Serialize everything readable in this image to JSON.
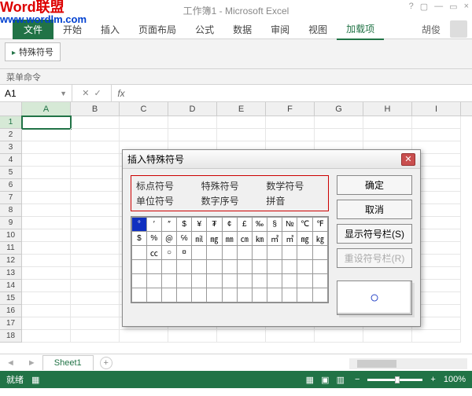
{
  "watermark": {
    "line1": "Word联盟",
    "line2": "www.wordlm.com"
  },
  "titlebar": {
    "title": "工作簿1 - Microsoft Excel"
  },
  "ribbon": {
    "tabs": {
      "file": "文件",
      "start": "开始",
      "insert": "插入",
      "layout": "页面布局",
      "formulas": "公式",
      "data": "数据",
      "review": "审阅",
      "view": "视图",
      "addins": "加载项"
    },
    "user": "胡俊",
    "special_symbol_btn": "特殊符号",
    "group_label": "菜单命令"
  },
  "formula": {
    "name_box": "A1",
    "fx": "fx"
  },
  "sheet": {
    "cols": [
      "A",
      "B",
      "C",
      "D",
      "E",
      "F",
      "G",
      "H",
      "I"
    ],
    "rows": [
      "1",
      "2",
      "3",
      "4",
      "5",
      "6",
      "7",
      "8",
      "9",
      "10",
      "11",
      "12",
      "13",
      "14",
      "15",
      "16",
      "17",
      "18"
    ],
    "tab": "Sheet1"
  },
  "status": {
    "ready": "就绪",
    "zoom": "100%"
  },
  "dialog": {
    "title": "插入特殊符号",
    "categories": {
      "punct": "标点符号",
      "special": "特殊符号",
      "math": "数学符号",
      "unit": "单位符号",
      "numseq": "数字序号",
      "pinyin": "拼音"
    },
    "buttons": {
      "ok": "确定",
      "cancel": "取消",
      "showbar": "显示符号栏(S)",
      "resetbar": "重设符号栏(R)"
    },
    "grid_row1": [
      "°",
      "′",
      "″",
      "$",
      "¥",
      "₮",
      "¢",
      "£",
      "‰",
      "§",
      "№",
      "℃",
      "℉"
    ],
    "grid_row2": [
      "$",
      "%",
      "＠",
      "℅",
      "㏕",
      "㎎",
      "㎜",
      "㎝",
      "㎞",
      "㎡",
      "㎥",
      "㎎",
      "㎏"
    ],
    "grid_row3": [
      "",
      "㏄",
      "○",
      "¤",
      "",
      "",
      "",
      "",
      "",
      "",
      "",
      "",
      ""
    ],
    "preview": "○"
  }
}
